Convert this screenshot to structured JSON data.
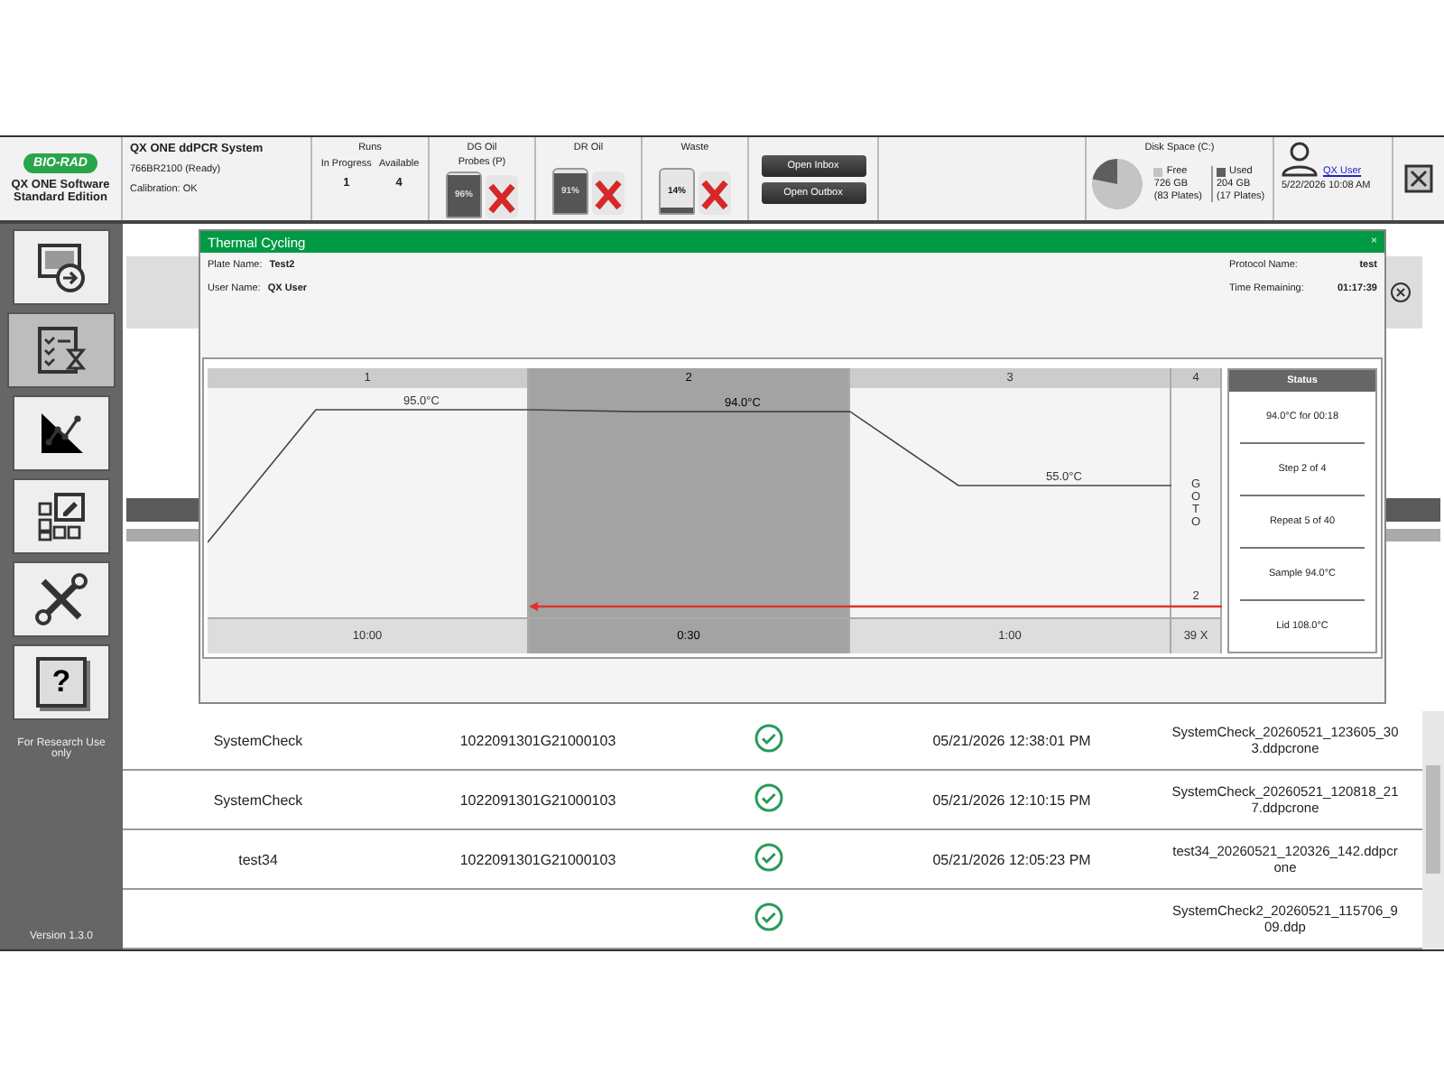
{
  "header": {
    "logo": "BIO-RAD",
    "product": "QX ONE Software Standard Edition",
    "system": {
      "name": "QX ONE ddPCR System",
      "serial": "766BR2100 (Ready)",
      "calibration": "Calibration: OK"
    },
    "runs": {
      "title": "Runs",
      "columns": [
        {
          "label": "In Progress",
          "value": "1"
        },
        {
          "label": "Available",
          "value": "4"
        }
      ]
    },
    "reagents": [
      {
        "title": "DG Oil",
        "subtitle": "Probes (P)",
        "level": 0.96,
        "reading": "96%",
        "error": true
      },
      {
        "title": "DR Oil",
        "level": 0.91,
        "reading": "91%",
        "error": true
      },
      {
        "title": "Waste",
        "level": 0.14,
        "reading": "14%",
        "error": true
      }
    ],
    "buttons": [
      "Open Inbox",
      "Open Outbox"
    ],
    "disk": {
      "title": "Disk Space (C:)",
      "chart_data": {
        "type": "pie",
        "categories": [
          "Free",
          "Used"
        ],
        "values": [
          78.1,
          21.9
        ]
      },
      "legend": [
        {
          "color": "#c4c4c4",
          "size": "726 GB",
          "plates": "(83 Plates)"
        },
        {
          "color": "#5e5e5e",
          "size": "204 GB",
          "plates": "(17 Plates)"
        }
      ]
    },
    "user": {
      "name": "QX User",
      "datetime": "5/22/2026 10:08 AM"
    }
  },
  "sidebar": {
    "items": [
      {
        "kind": "plate-run",
        "selected": false
      },
      {
        "kind": "checklist",
        "selected": true
      },
      {
        "kind": "chart",
        "selected": false
      },
      {
        "kind": "layout",
        "selected": false
      },
      {
        "kind": "tools",
        "selected": false
      },
      {
        "kind": "help",
        "label": "?",
        "selected": false
      }
    ],
    "note": "For Research Use only",
    "version": "Version 1.3.0"
  },
  "dialog": {
    "title": "Thermal Cycling",
    "close": "×",
    "fields_left": [
      {
        "label": "Plate Name:",
        "value": "Test2"
      },
      {
        "label": "User Name:",
        "value": "QX User"
      }
    ],
    "fields_right": [
      {
        "label": "Protocol Name:",
        "value": "test"
      },
      {
        "label": "Time Remaining:",
        "value": "01:17:39"
      }
    ],
    "steps": [
      {
        "number": "1",
        "temperature": "95.0°C",
        "time": "10:00",
        "selected": false
      },
      {
        "number": "2",
        "temperature": "94.0°C",
        "time": "0:30",
        "selected": true
      },
      {
        "number": "3",
        "temperature": "55.0°C",
        "time": "1:00",
        "selected": false
      }
    ],
    "goto": {
      "number": "4",
      "label": "GOTO",
      "target": "2",
      "cycles": "39 X"
    },
    "status": {
      "title": "Status",
      "lines": [
        "94.0°C for 00:18",
        "Step 2 of 4",
        "Repeat 5 of 40",
        "Sample 94.0°C",
        "Lid 108.0°C"
      ]
    }
  },
  "table": {
    "rows": [
      {
        "name": "SystemCheck",
        "barcode": "1022091301G21000103",
        "ok": true,
        "date": "05/21/2026 12:38:01 PM",
        "file": "SystemCheck_20260521_123605_303.ddpcrone"
      },
      {
        "name": "SystemCheck",
        "barcode": "1022091301G21000103",
        "ok": true,
        "date": "05/21/2026 12:10:15 PM",
        "file": "SystemCheck_20260521_120818_217.ddpcrone"
      },
      {
        "name": "test34",
        "barcode": "1022091301G21000103",
        "ok": true,
        "date": "05/21/2026 12:05:23 PM",
        "file": "test34_20260521_120326_142.ddpcrone"
      },
      {
        "ok": true,
        "file": "SystemCheck2_20260521_115706_909.ddp"
      }
    ]
  }
}
